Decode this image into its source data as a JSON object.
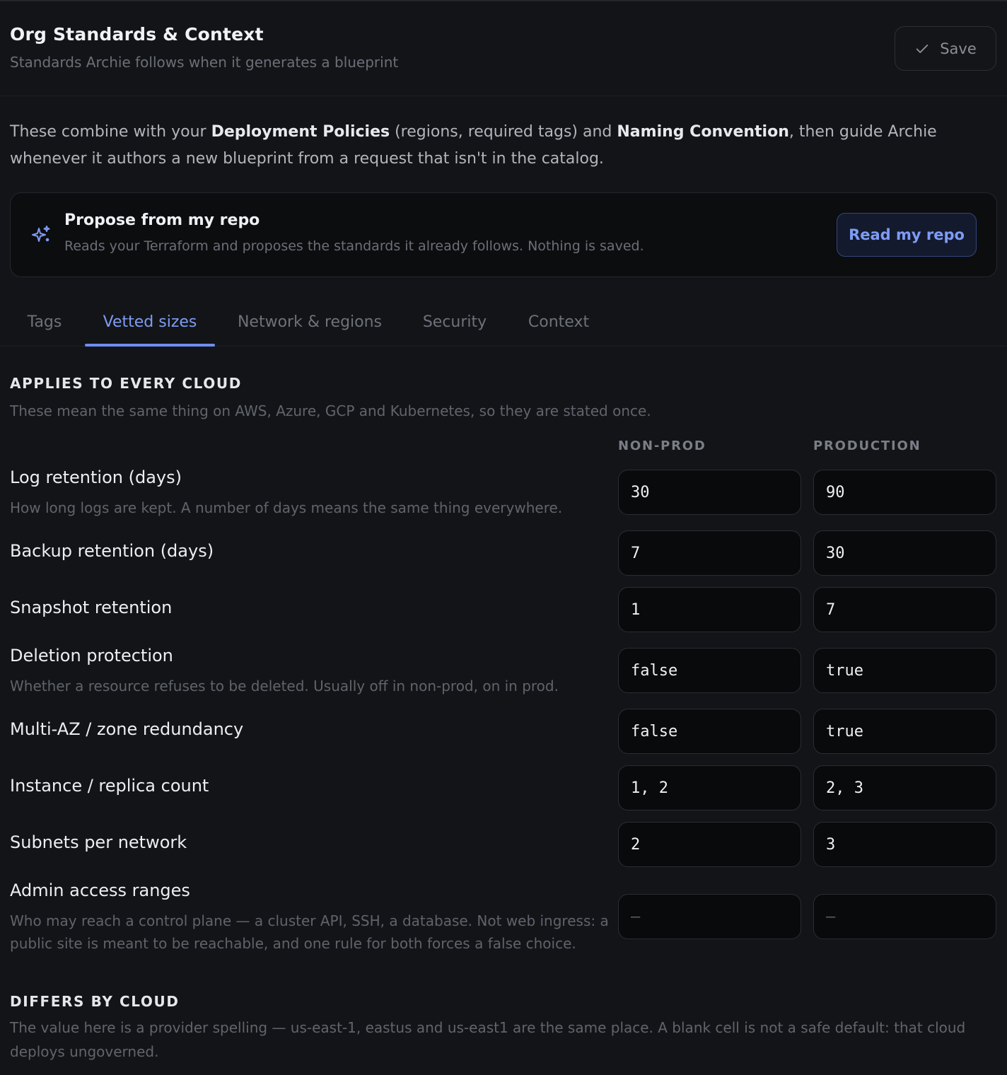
{
  "header": {
    "title": "Org Standards & Context",
    "subtitle": "Standards Archie follows when it generates a blueprint",
    "save_label": "Save"
  },
  "intro": {
    "p1": "These combine with your ",
    "b1": "Deployment Policies",
    "p2": " (regions, required tags) and ",
    "b2": "Naming Convention",
    "p3": ", then guide Archie whenever it authors a new blueprint from a request that isn't in the catalog."
  },
  "propose": {
    "title": "Propose from my repo",
    "description": "Reads your Terraform and proposes the standards it already follows. Nothing is saved.",
    "button_label": "Read my repo"
  },
  "tabs": [
    {
      "label": "Tags"
    },
    {
      "label": "Vetted sizes",
      "active": true
    },
    {
      "label": "Network & regions"
    },
    {
      "label": "Security"
    },
    {
      "label": "Context"
    }
  ],
  "applies": {
    "heading": "APPLIES TO EVERY CLOUD",
    "description": "These mean the same thing on AWS, Azure, GCP and Kubernetes, so they are stated once.",
    "col_nonprod": "NON-PROD",
    "col_prod": "PRODUCTION",
    "rows": [
      {
        "label": "Log retention (days)",
        "desc": "How long logs are kept. A number of days means the same thing everywhere.",
        "nonprod": "30",
        "prod": "90"
      },
      {
        "label": "Backup retention (days)",
        "desc": "",
        "nonprod": "7",
        "prod": "30"
      },
      {
        "label": "Snapshot retention",
        "desc": "",
        "nonprod": "1",
        "prod": "7"
      },
      {
        "label": "Deletion protection",
        "desc": "Whether a resource refuses to be deleted. Usually off in non-prod, on in prod.",
        "nonprod": "false",
        "prod": "true"
      },
      {
        "label": "Multi-AZ / zone redundancy",
        "desc": "",
        "nonprod": "false",
        "prod": "true"
      },
      {
        "label": "Instance / replica count",
        "desc": "",
        "nonprod": "1, 2",
        "prod": "2, 3"
      },
      {
        "label": "Subnets per network",
        "desc": "",
        "nonprod": "2",
        "prod": "3"
      },
      {
        "label": "Admin access ranges",
        "desc": "Who may reach a control plane — a cluster API, SSH, a database. Not web ingress: a public site is meant to be reachable, and one rule for both forces a false choice.",
        "nonprod": "—",
        "prod": "—"
      }
    ]
  },
  "differs": {
    "heading": "DIFFERS BY CLOUD",
    "description": "The value here is a provider spelling — us-east-1, eastus and us-east1 are the same place. A blank cell is not a safe default: that cloud deploys ungoverned."
  },
  "colors": {
    "accent": "#7e9cf5",
    "background": "#131417"
  }
}
